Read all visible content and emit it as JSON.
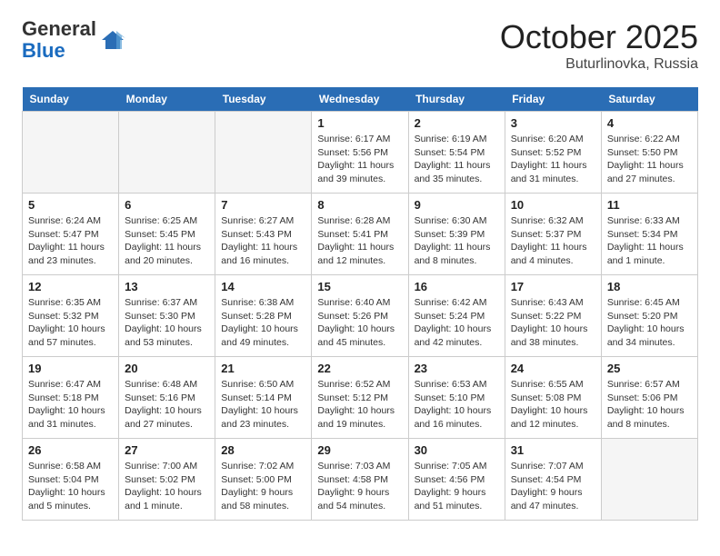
{
  "header": {
    "logo_general": "General",
    "logo_blue": "Blue",
    "month": "October 2025",
    "location": "Buturlinovka, Russia"
  },
  "weekdays": [
    "Sunday",
    "Monday",
    "Tuesday",
    "Wednesday",
    "Thursday",
    "Friday",
    "Saturday"
  ],
  "weeks": [
    [
      {
        "num": "",
        "info": ""
      },
      {
        "num": "",
        "info": ""
      },
      {
        "num": "",
        "info": ""
      },
      {
        "num": "1",
        "info": "Sunrise: 6:17 AM\nSunset: 5:56 PM\nDaylight: 11 hours\nand 39 minutes."
      },
      {
        "num": "2",
        "info": "Sunrise: 6:19 AM\nSunset: 5:54 PM\nDaylight: 11 hours\nand 35 minutes."
      },
      {
        "num": "3",
        "info": "Sunrise: 6:20 AM\nSunset: 5:52 PM\nDaylight: 11 hours\nand 31 minutes."
      },
      {
        "num": "4",
        "info": "Sunrise: 6:22 AM\nSunset: 5:50 PM\nDaylight: 11 hours\nand 27 minutes."
      }
    ],
    [
      {
        "num": "5",
        "info": "Sunrise: 6:24 AM\nSunset: 5:47 PM\nDaylight: 11 hours\nand 23 minutes."
      },
      {
        "num": "6",
        "info": "Sunrise: 6:25 AM\nSunset: 5:45 PM\nDaylight: 11 hours\nand 20 minutes."
      },
      {
        "num": "7",
        "info": "Sunrise: 6:27 AM\nSunset: 5:43 PM\nDaylight: 11 hours\nand 16 minutes."
      },
      {
        "num": "8",
        "info": "Sunrise: 6:28 AM\nSunset: 5:41 PM\nDaylight: 11 hours\nand 12 minutes."
      },
      {
        "num": "9",
        "info": "Sunrise: 6:30 AM\nSunset: 5:39 PM\nDaylight: 11 hours\nand 8 minutes."
      },
      {
        "num": "10",
        "info": "Sunrise: 6:32 AM\nSunset: 5:37 PM\nDaylight: 11 hours\nand 4 minutes."
      },
      {
        "num": "11",
        "info": "Sunrise: 6:33 AM\nSunset: 5:34 PM\nDaylight: 11 hours\nand 1 minute."
      }
    ],
    [
      {
        "num": "12",
        "info": "Sunrise: 6:35 AM\nSunset: 5:32 PM\nDaylight: 10 hours\nand 57 minutes."
      },
      {
        "num": "13",
        "info": "Sunrise: 6:37 AM\nSunset: 5:30 PM\nDaylight: 10 hours\nand 53 minutes."
      },
      {
        "num": "14",
        "info": "Sunrise: 6:38 AM\nSunset: 5:28 PM\nDaylight: 10 hours\nand 49 minutes."
      },
      {
        "num": "15",
        "info": "Sunrise: 6:40 AM\nSunset: 5:26 PM\nDaylight: 10 hours\nand 45 minutes."
      },
      {
        "num": "16",
        "info": "Sunrise: 6:42 AM\nSunset: 5:24 PM\nDaylight: 10 hours\nand 42 minutes."
      },
      {
        "num": "17",
        "info": "Sunrise: 6:43 AM\nSunset: 5:22 PM\nDaylight: 10 hours\nand 38 minutes."
      },
      {
        "num": "18",
        "info": "Sunrise: 6:45 AM\nSunset: 5:20 PM\nDaylight: 10 hours\nand 34 minutes."
      }
    ],
    [
      {
        "num": "19",
        "info": "Sunrise: 6:47 AM\nSunset: 5:18 PM\nDaylight: 10 hours\nand 31 minutes."
      },
      {
        "num": "20",
        "info": "Sunrise: 6:48 AM\nSunset: 5:16 PM\nDaylight: 10 hours\nand 27 minutes."
      },
      {
        "num": "21",
        "info": "Sunrise: 6:50 AM\nSunset: 5:14 PM\nDaylight: 10 hours\nand 23 minutes."
      },
      {
        "num": "22",
        "info": "Sunrise: 6:52 AM\nSunset: 5:12 PM\nDaylight: 10 hours\nand 19 minutes."
      },
      {
        "num": "23",
        "info": "Sunrise: 6:53 AM\nSunset: 5:10 PM\nDaylight: 10 hours\nand 16 minutes."
      },
      {
        "num": "24",
        "info": "Sunrise: 6:55 AM\nSunset: 5:08 PM\nDaylight: 10 hours\nand 12 minutes."
      },
      {
        "num": "25",
        "info": "Sunrise: 6:57 AM\nSunset: 5:06 PM\nDaylight: 10 hours\nand 8 minutes."
      }
    ],
    [
      {
        "num": "26",
        "info": "Sunrise: 6:58 AM\nSunset: 5:04 PM\nDaylight: 10 hours\nand 5 minutes."
      },
      {
        "num": "27",
        "info": "Sunrise: 7:00 AM\nSunset: 5:02 PM\nDaylight: 10 hours\nand 1 minute."
      },
      {
        "num": "28",
        "info": "Sunrise: 7:02 AM\nSunset: 5:00 PM\nDaylight: 9 hours\nand 58 minutes."
      },
      {
        "num": "29",
        "info": "Sunrise: 7:03 AM\nSunset: 4:58 PM\nDaylight: 9 hours\nand 54 minutes."
      },
      {
        "num": "30",
        "info": "Sunrise: 7:05 AM\nSunset: 4:56 PM\nDaylight: 9 hours\nand 51 minutes."
      },
      {
        "num": "31",
        "info": "Sunrise: 7:07 AM\nSunset: 4:54 PM\nDaylight: 9 hours\nand 47 minutes."
      },
      {
        "num": "",
        "info": ""
      }
    ]
  ]
}
